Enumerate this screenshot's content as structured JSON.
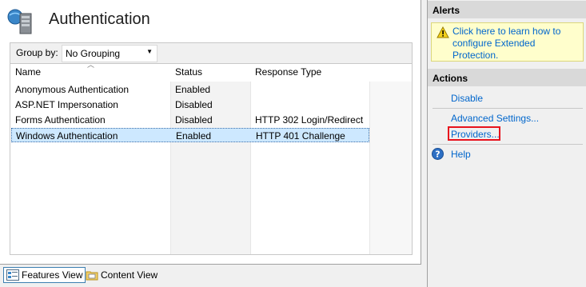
{
  "page": {
    "title": "Authentication",
    "icon": "server-icon"
  },
  "groupby": {
    "label": "Group by:",
    "value": "No Grouping"
  },
  "grid": {
    "columns": [
      "Name",
      "Status",
      "Response Type"
    ],
    "rows": [
      {
        "name": "Anonymous Authentication",
        "status": "Enabled",
        "response": ""
      },
      {
        "name": "ASP.NET Impersonation",
        "status": "Disabled",
        "response": ""
      },
      {
        "name": "Forms Authentication",
        "status": "Disabled",
        "response": "HTTP 302 Login/Redirect"
      },
      {
        "name": "Windows Authentication",
        "status": "Enabled",
        "response": "HTTP 401 Challenge",
        "selected": true
      }
    ]
  },
  "tabs": [
    {
      "label": "Features View",
      "active": true,
      "icon": "features-view-icon"
    },
    {
      "label": "Content View",
      "active": false,
      "icon": "content-view-icon"
    }
  ],
  "alerts": {
    "header": "Alerts",
    "message": "Click here to learn how to configure Extended Protection.",
    "icon": "warning-icon"
  },
  "actions": {
    "header": "Actions",
    "disable": "Disable",
    "advanced": "Advanced Settings...",
    "providers": "Providers...",
    "help": "Help",
    "help_icon": "help-icon"
  },
  "colors": {
    "link": "#0066cc",
    "selection": "#cde8ff",
    "highlight_box": "#e8121c",
    "alert_bg": "#fffecc"
  }
}
